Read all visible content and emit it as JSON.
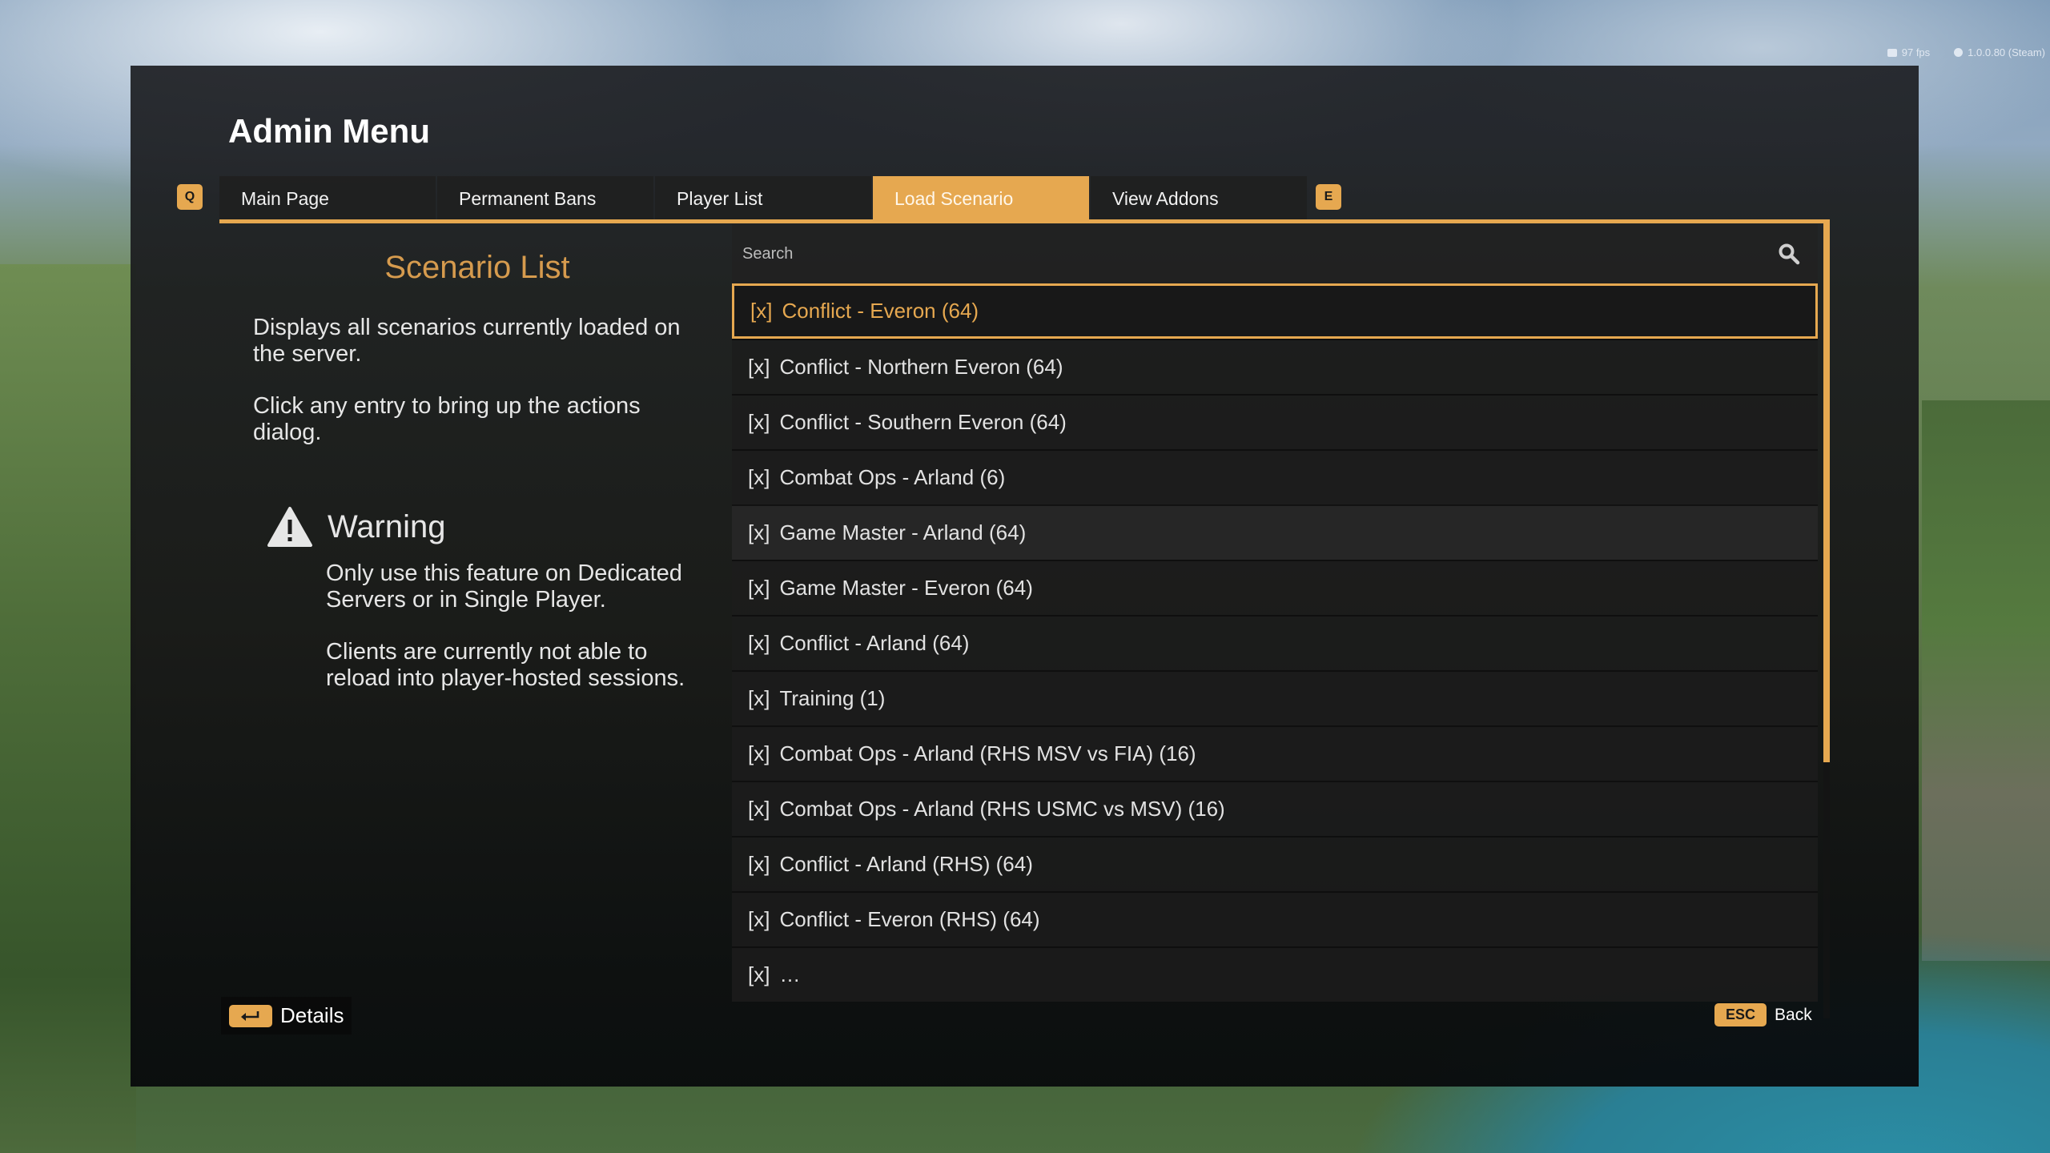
{
  "hud": {
    "fps": "97 fps",
    "version": "1.0.0.80 (Steam)"
  },
  "window": {
    "title": "Admin Menu"
  },
  "tabs": {
    "prev_key": "Q",
    "next_key": "E",
    "items": [
      {
        "label": "Main Page",
        "active": false
      },
      {
        "label": "Permanent Bans",
        "active": false
      },
      {
        "label": "Player List",
        "active": false
      },
      {
        "label": "Load Scenario",
        "active": true
      },
      {
        "label": "View Addons",
        "active": false
      }
    ]
  },
  "info": {
    "title": "Scenario List",
    "paragraphs": [
      "Displays all scenarios currently loaded on the server.",
      "Click any entry to bring up the actions dialog."
    ]
  },
  "warning": {
    "icon": "warning-triangle-icon",
    "title": "Warning",
    "paragraphs": [
      "Only use this feature on Dedicated Servers or in Single Player.",
      "Clients are currently not able to reload into player-hosted sessions."
    ]
  },
  "search": {
    "placeholder": "Search",
    "value": "",
    "icon": "search-icon"
  },
  "scenarios": {
    "marker": "[x]",
    "selected_index": 0,
    "items": [
      "Conflict - Everon (64)",
      "Conflict - Northern Everon (64)",
      "Conflict - Southern Everon (64)",
      "Combat Ops - Arland (6)",
      "Game Master - Arland (64)",
      "Game Master - Everon (64)",
      "Conflict - Arland (64)",
      "Training (1)",
      "Combat Ops - Arland (RHS MSV vs FIA)  (16)",
      "Combat Ops - Arland (RHS USMC vs MSV)  (16)",
      "Conflict - Arland  (RHS)  (64)",
      "Conflict - Everon  (RHS)  (64)",
      "…"
    ]
  },
  "footer": {
    "details_key_icon": "enter-key-icon",
    "details_label": "Details",
    "back_key": "ESC",
    "back_label": "Back"
  },
  "colors": {
    "accent": "#e6a850",
    "panel": "#1e2024",
    "text": "#e2e2e2",
    "info_title": "#d69b4e"
  }
}
